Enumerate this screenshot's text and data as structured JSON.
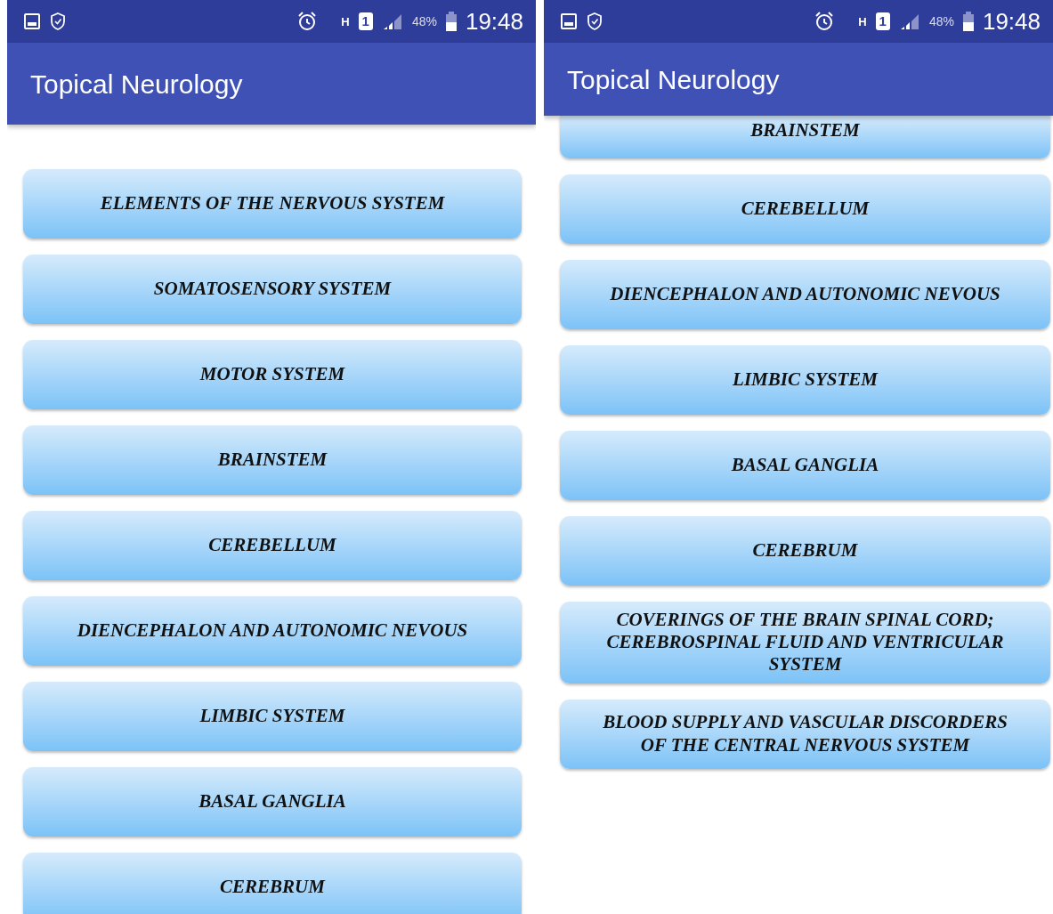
{
  "screens": [
    {
      "status_bar": {
        "network": "H",
        "sim": "1",
        "battery": "48%",
        "time": "19:48"
      },
      "title": "Topical Neurology",
      "items": [
        "ELEMENTS OF THE NERVOUS SYSTEM",
        "SOMATOSENSORY SYSTEM",
        "MOTOR SYSTEM",
        "BRAINSTEM",
        "CEREBELLUM",
        "DIENCEPHALON AND AUTONOMIC NEVOUS",
        "LIMBIC SYSTEM",
        "BASAL GANGLIA",
        "CEREBRUM"
      ]
    },
    {
      "status_bar": {
        "network": "H",
        "sim": "1",
        "battery": "48%",
        "time": "19:48"
      },
      "title": "Topical Neurology",
      "items": [
        "BRAINSTEM",
        "CEREBELLUM",
        "DIENCEPHALON AND AUTONOMIC NEVOUS",
        "LIMBIC SYSTEM",
        "BASAL GANGLIA",
        "CEREBRUM",
        "COVERINGS OF THE BRAIN SPINAL CORD; CEREBROSPINAL FLUID AND VENTRICULAR SYSTEM",
        "BLOOD SUPPLY AND VASCULAR DISCORDERS OF THE CENTRAL NERVOUS SYSTEM"
      ]
    }
  ]
}
